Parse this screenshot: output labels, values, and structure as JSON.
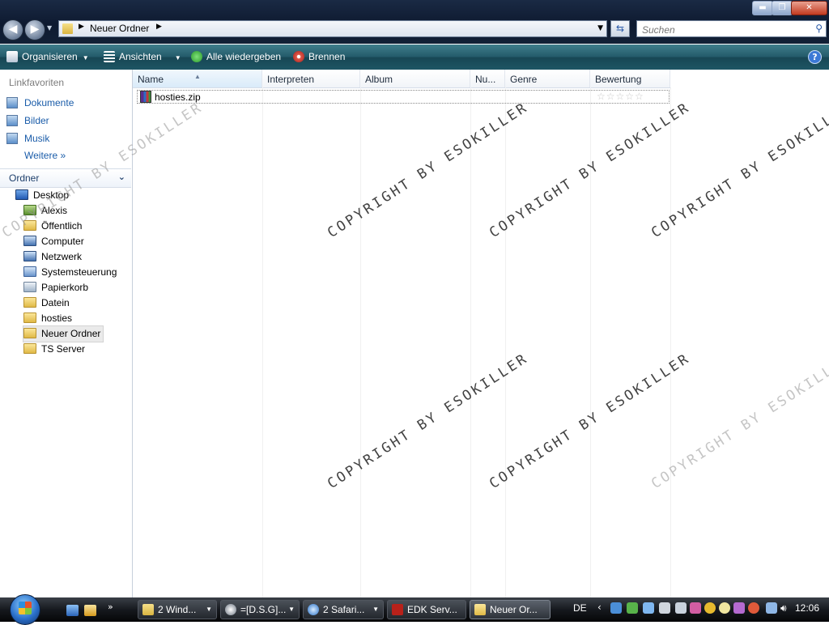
{
  "window": {
    "title_buttons": {
      "minimize": "▬",
      "maximize": "❐",
      "close": "✕"
    }
  },
  "nav": {
    "back": "◀",
    "forward": "▶"
  },
  "address": {
    "path": "Neuer Ordner"
  },
  "search": {
    "placeholder": "Suchen"
  },
  "toolbar": {
    "organize": "Organisieren",
    "views": "Ansichten",
    "play_all": "Alle wiedergeben",
    "burn": "Brennen",
    "help": "?"
  },
  "sidebar": {
    "favorites_header": "Linkfavoriten",
    "favorites": [
      {
        "label": "Dokumente",
        "icon": "documents-icon"
      },
      {
        "label": "Bilder",
        "icon": "pictures-icon"
      },
      {
        "label": "Musik",
        "icon": "music-icon"
      }
    ],
    "more": "Weitere",
    "folders_header": "Ordner",
    "tree": [
      {
        "label": "Desktop",
        "icon": "desktop-icon"
      },
      {
        "label": "Alexis",
        "icon": "user-folder-icon"
      },
      {
        "label": "Öffentlich",
        "icon": "folder-icon"
      },
      {
        "label": "Computer",
        "icon": "computer-icon"
      },
      {
        "label": "Netzwerk",
        "icon": "network-icon"
      },
      {
        "label": "Systemsteuerung",
        "icon": "control-panel-icon"
      },
      {
        "label": "Papierkorb",
        "icon": "recycle-bin-icon"
      },
      {
        "label": "Datein",
        "icon": "folder-icon"
      },
      {
        "label": "hosties",
        "icon": "folder-icon"
      },
      {
        "label": "Neuer Ordner",
        "icon": "folder-icon",
        "selected": true
      },
      {
        "label": "TS Server",
        "icon": "folder-icon"
      }
    ]
  },
  "filelist": {
    "columns": [
      "Name",
      "Interpreten",
      "Album",
      "Nu...",
      "Genre",
      "Bewertung"
    ],
    "rows": [
      {
        "name": "hosties.zip",
        "icon": "zip-archive-icon",
        "rating": "☆☆☆☆☆"
      }
    ]
  },
  "watermark": {
    "text": "COPYRIGHT BY ESOKILLER"
  },
  "taskbar": {
    "tasks": [
      {
        "label": "2 Wind...",
        "icon": "explorer-icon"
      },
      {
        "label": "=[D.S.G]...",
        "icon": "steam-icon"
      },
      {
        "label": "2 Safari...",
        "icon": "safari-icon"
      },
      {
        "label": "EDK Serv...",
        "icon": "filezilla-icon"
      },
      {
        "label": "Neuer Or...",
        "icon": "folder-icon"
      }
    ],
    "language": "DE",
    "clock": "12:06"
  },
  "colors": {
    "titlebar": "#0e1a30",
    "command_bar": "#1e5564",
    "link_blue": "#1a5ca9",
    "taskbar": "#16191e"
  }
}
